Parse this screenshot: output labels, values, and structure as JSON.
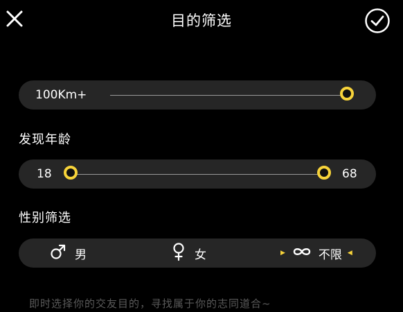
{
  "header": {
    "title": "目的筛选",
    "close_icon": "close-icon",
    "confirm_icon": "check-circle-icon"
  },
  "distance": {
    "label": "100Km+",
    "value_fraction": 1.0
  },
  "age": {
    "section_label": "发现年龄",
    "min_value": "18",
    "max_value": "68"
  },
  "gender": {
    "section_label": "性别筛选",
    "options": [
      {
        "label": "男",
        "icon": "male-icon",
        "selected": false
      },
      {
        "label": "女",
        "icon": "female-icon",
        "selected": false
      },
      {
        "label": "不限",
        "icon": "infinity-icon",
        "selected": true
      }
    ]
  },
  "footer": {
    "hint": "即时选择你的交友目的，寻找属于你的志同道合~"
  },
  "colors": {
    "accent": "#f7d33a",
    "pill_bg": "#262626",
    "background": "#000000",
    "hint_text": "#5a5a5a"
  }
}
